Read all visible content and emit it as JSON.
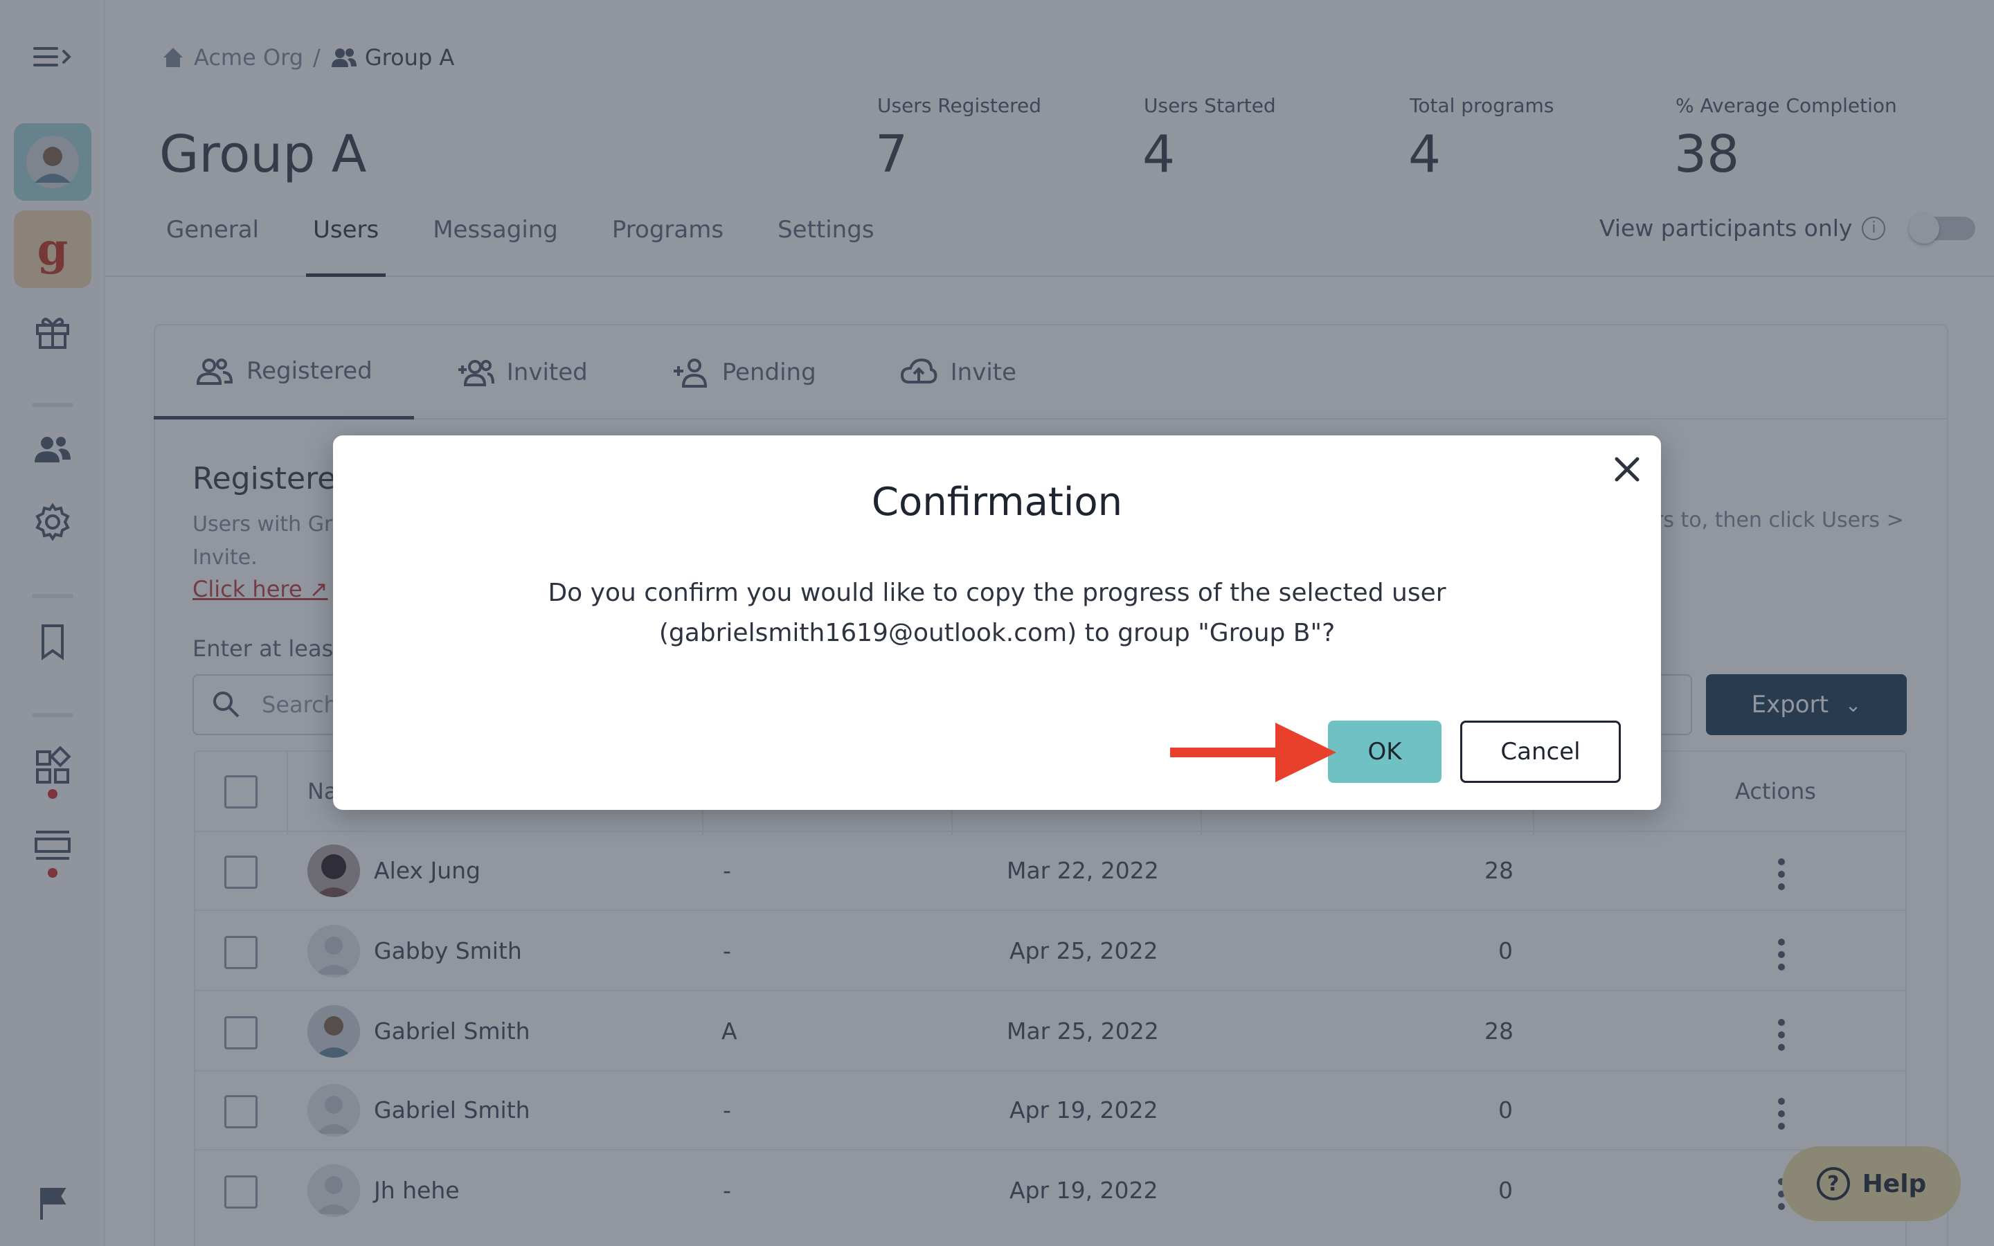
{
  "breadcrumb": {
    "org": "Acme Org",
    "separator": "/",
    "group": "Group A"
  },
  "page": {
    "title": "Group A"
  },
  "stats": [
    {
      "label": "Users Registered",
      "value": "7"
    },
    {
      "label": "Users Started",
      "value": "4"
    },
    {
      "label": "Total programs",
      "value": "4"
    },
    {
      "label": "% Average Completion",
      "value": "38"
    }
  ],
  "main_tabs": [
    "General",
    "Users",
    "Messaging",
    "Programs",
    "Settings"
  ],
  "main_tab_active": "Users",
  "participants_toggle": {
    "label": "View participants only",
    "info": "i",
    "on": false
  },
  "sub_tabs": [
    "Registered",
    "Invited",
    "Pending",
    "Invite"
  ],
  "section": {
    "title": "Registered",
    "desc_line1": "Users with Gr",
    "desc_line2": "Invite.",
    "desc_right": "rs to, then click Users >",
    "click_here": "Click here ↗",
    "enter_label": "Enter at least"
  },
  "search": {
    "placeholder": "Search"
  },
  "export": {
    "label": "Export"
  },
  "table": {
    "header_name": "Na",
    "header_actions": "Actions",
    "rows": [
      {
        "name": "Alex Jung",
        "group": "-",
        "date": "Mar 22, 2022",
        "progress": "28"
      },
      {
        "name": "Gabby Smith",
        "group": "-",
        "date": "Apr 25, 2022",
        "progress": "0"
      },
      {
        "name": "Gabriel Smith",
        "group": "A",
        "date": "Mar 25, 2022",
        "progress": "28"
      },
      {
        "name": "Gabriel Smith",
        "group": "-",
        "date": "Apr 19, 2022",
        "progress": "0"
      },
      {
        "name": "Jh hehe",
        "group": "-",
        "date": "Apr 19, 2022",
        "progress": "0"
      }
    ]
  },
  "help": {
    "label": "Help",
    "q": "?"
  },
  "modal": {
    "title": "Confirmation",
    "body_line1": "Do you confirm you would like to copy the progress of the selected user",
    "body_line2": "(gabrielsmith1619@outlook.com) to group \"Group B\"?",
    "ok": "OK",
    "cancel": "Cancel"
  },
  "sidebar": {
    "org_initial": "g"
  },
  "colors": {
    "ok_button": "#6fc1c4",
    "export_button": "#2e4a5e",
    "arrow": "#e8402a",
    "overlay": "#232d40"
  }
}
